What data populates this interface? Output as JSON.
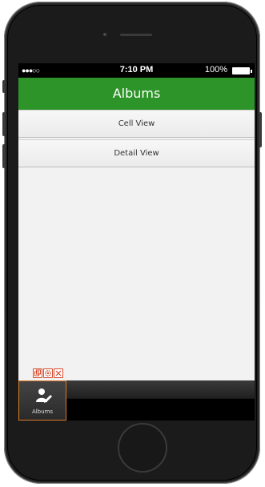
{
  "status_bar": {
    "signal": "●●●○○",
    "time": "7:10 PM",
    "battery": "100%"
  },
  "nav": {
    "title": "Albums"
  },
  "list": [
    {
      "label": "Cell View"
    },
    {
      "label": "Detail View"
    }
  ],
  "tab_bar": {
    "items": [
      {
        "label": "Albums",
        "icon": "user-edit-icon"
      }
    ]
  },
  "edit_toolbar": {
    "buttons": [
      "duplicate-icon",
      "settings-icon",
      "close-icon"
    ]
  },
  "colors": {
    "nav_bar": "#2d9429",
    "selection": "#d97a2b"
  }
}
